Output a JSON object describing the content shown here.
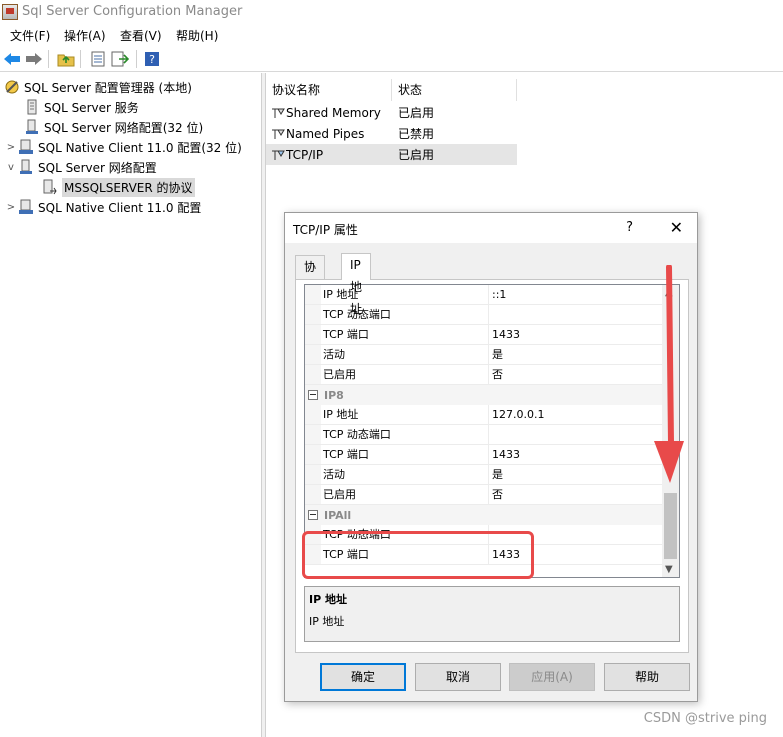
{
  "window": {
    "title": "Sql Server Configuration Manager"
  },
  "menu": [
    "文件(F)",
    "操作(A)",
    "查看(V)",
    "帮助(H)"
  ],
  "toolbar": {
    "items": [
      "back-icon",
      "forward-icon",
      "up-folder-icon",
      "properties-icon",
      "export-icon",
      "help-icon"
    ]
  },
  "tree": {
    "root": "SQL Server 配置管理器 (本地)",
    "items": [
      {
        "label": "SQL Server 服务",
        "expander": ""
      },
      {
        "label": "SQL Server 网络配置(32 位)",
        "expander": ""
      },
      {
        "label": "SQL Native Client 11.0 配置(32 位)",
        "expander": ">"
      },
      {
        "label": "SQL Server 网络配置",
        "expander": "v"
      },
      {
        "label": "MSSQLSERVER 的协议",
        "expander": ""
      },
      {
        "label": "SQL Native Client 11.0 配置",
        "expander": ">"
      }
    ]
  },
  "list": {
    "columns": [
      "协议名称",
      "状态"
    ],
    "rows": [
      {
        "name": "Shared Memory",
        "status": "已启用"
      },
      {
        "name": "Named Pipes",
        "status": "已禁用"
      },
      {
        "name": "TCP/IP",
        "status": "已启用"
      }
    ]
  },
  "dialog": {
    "title": "TCP/IP 属性",
    "help_glyph": "?",
    "close_glyph": "✕",
    "tabs": [
      "协议",
      "IP 地址"
    ],
    "grid": {
      "rows": [
        {
          "name": "IP 地址",
          "value": "::1"
        },
        {
          "name": "TCP 动态端口",
          "value": ""
        },
        {
          "name": "TCP 端口",
          "value": "1433"
        },
        {
          "name": "活动",
          "value": "是"
        },
        {
          "name": "已启用",
          "value": "否"
        }
      ],
      "ip8": {
        "header": "IP8",
        "rows": [
          {
            "name": "IP 地址",
            "value": "127.0.0.1"
          },
          {
            "name": "TCP 动态端口",
            "value": ""
          },
          {
            "name": "TCP 端口",
            "value": "1433"
          },
          {
            "name": "活动",
            "value": "是"
          },
          {
            "name": "已启用",
            "value": "否"
          }
        ]
      },
      "ipall": {
        "header": "IPAll",
        "rows": [
          {
            "name": "TCP 动态端口",
            "value": ""
          },
          {
            "name": "TCP 端口",
            "value": "1433"
          }
        ]
      }
    },
    "description": {
      "title": "IP 地址",
      "text": "IP 地址"
    },
    "buttons": {
      "ok": "确定",
      "cancel": "取消",
      "apply": "应用(A)",
      "help": "帮助"
    }
  },
  "annotation_colors": {
    "highlight": "#e84a4a"
  },
  "watermark": "CSDN @strive ping"
}
